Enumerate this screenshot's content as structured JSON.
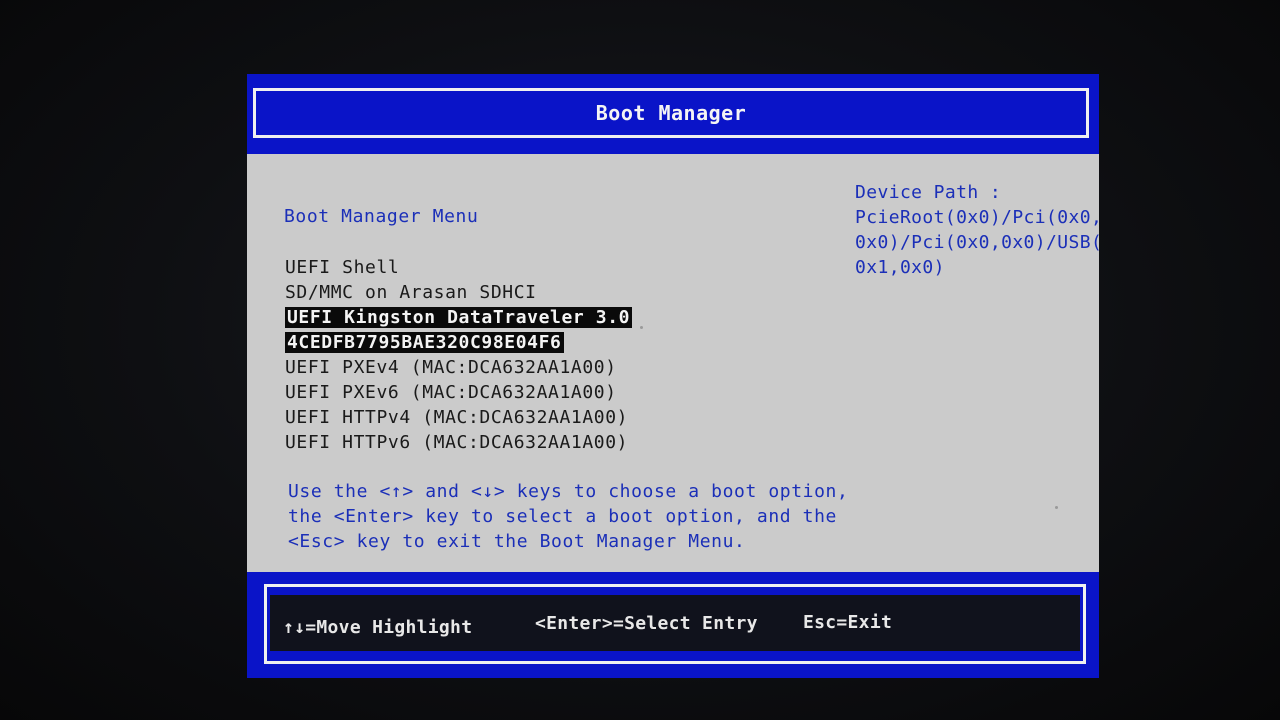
{
  "header": {
    "title": "Boot Manager"
  },
  "menu": {
    "title": "Boot Manager Menu",
    "items": [
      {
        "label": "UEFI Shell",
        "selected": false
      },
      {
        "label": "SD/MMC on Arasan SDHCI",
        "selected": false
      },
      {
        "label": "UEFI Kingston DataTraveler 3.0",
        "selected": true
      },
      {
        "label": "4CEDFB7795BAE320C98E04F6",
        "selected": true
      },
      {
        "label": "UEFI PXEv4 (MAC:DCA632AA1A00)",
        "selected": false
      },
      {
        "label": "UEFI PXEv6 (MAC:DCA632AA1A00)",
        "selected": false
      },
      {
        "label": "UEFI HTTPv4 (MAC:DCA632AA1A00)",
        "selected": false
      },
      {
        "label": "UEFI HTTPv6 (MAC:DCA632AA1A00)",
        "selected": false
      }
    ]
  },
  "help": {
    "lines": [
      "Use the <↑> and <↓> keys to choose a boot option,",
      "the <Enter> key to select a boot option, and the",
      "<Esc> key to exit the Boot Manager Menu."
    ]
  },
  "device_path": {
    "lines": [
      "Device Path :",
      "PcieRoot(0x0)/Pci(0x0,",
      "0x0)/Pci(0x0,0x0)/USB(",
      "0x1,0x0)"
    ]
  },
  "footer": {
    "move": "↑↓=Move Highlight",
    "select": "<Enter>=Select Entry",
    "exit": "Esc=Exit"
  },
  "colors": {
    "frame_blue": "#0a14c8",
    "text_blue": "#1b2fb8",
    "background_gray": "#c8c8c8",
    "highlight_bg": "#0a0a0a",
    "highlight_fg": "#f4f4f4"
  }
}
